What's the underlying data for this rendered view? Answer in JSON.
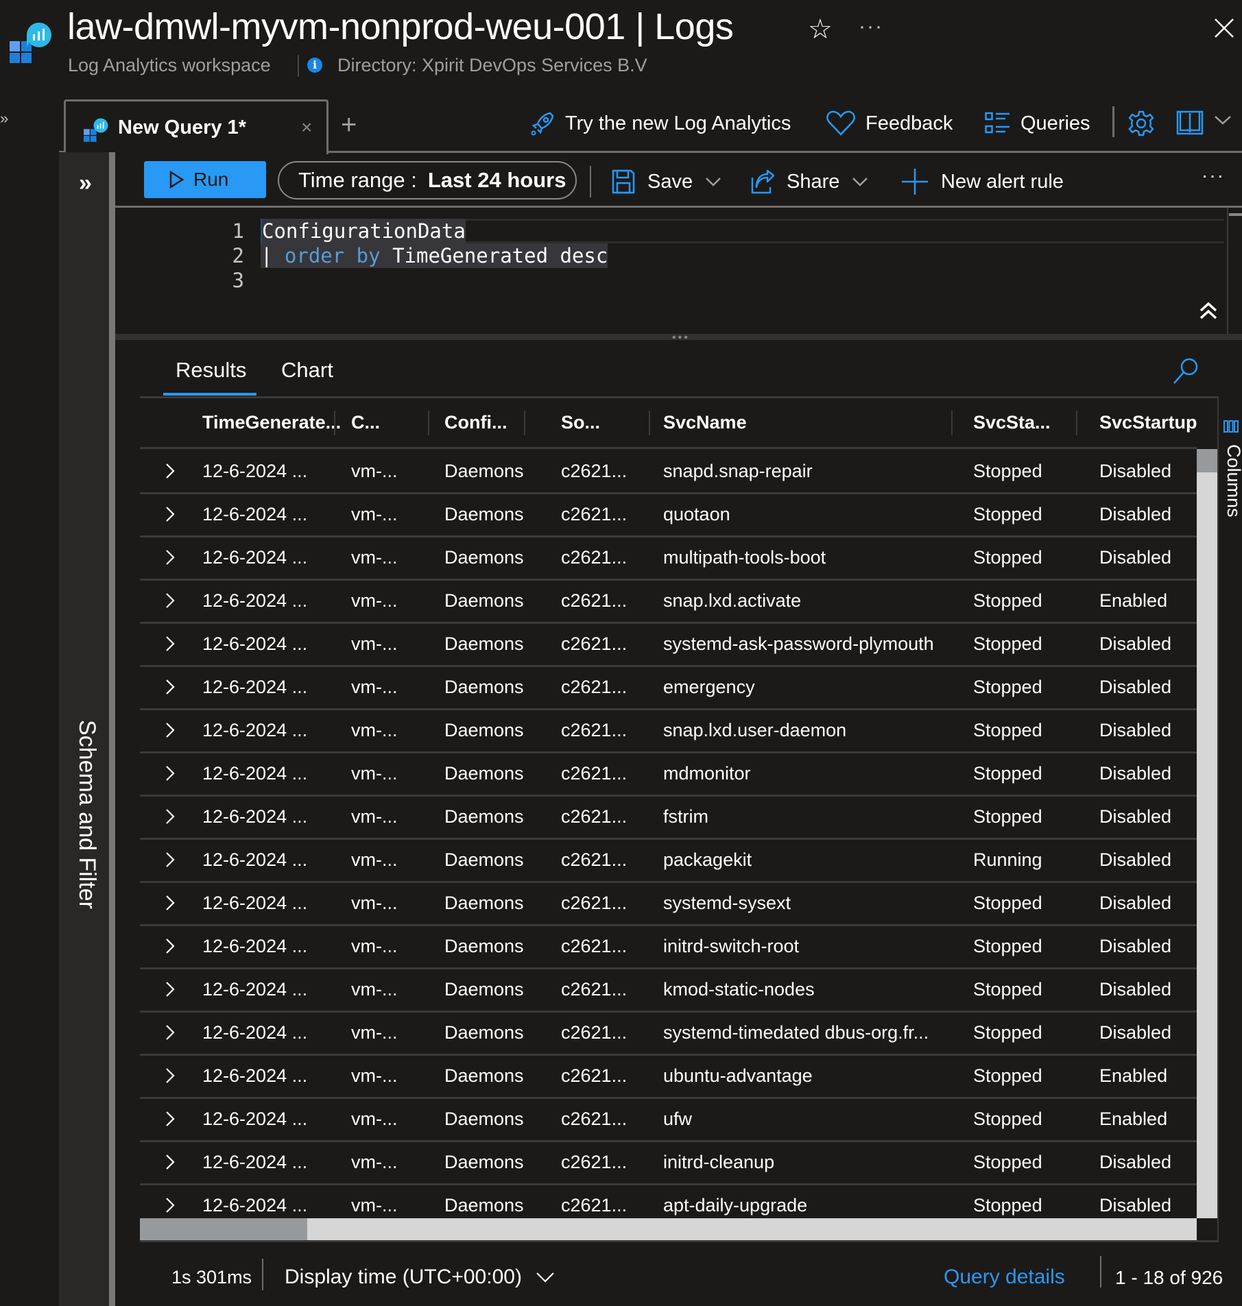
{
  "header": {
    "title": "law-dmwl-myvm-nonprod-weu-001 | Logs",
    "subtitle": "Log Analytics workspace",
    "directory": "Directory: Xpirit DevOps Services B.V",
    "info_icon": "i",
    "star_icon": "☆",
    "more_icon": "···",
    "close_icon": "close-icon"
  },
  "left_collapse_icon": "»",
  "query_tabs": [
    {
      "label": "New Query 1*",
      "close": "×",
      "active": true
    }
  ],
  "add_tab_icon": "+",
  "top_actions": {
    "try_new": "Try the new Log Analytics",
    "feedback": "Feedback",
    "queries": "Queries"
  },
  "schema_panel": {
    "expand_icon": "»",
    "label": "Schema and Filter"
  },
  "toolbar": {
    "run_label": "Run",
    "time_range_label": "Time range :",
    "time_range_value": "Last 24 hours",
    "save_label": "Save",
    "share_label": "Share",
    "new_alert_label": "New alert rule",
    "more_icon": "···"
  },
  "editor": {
    "lines": [
      {
        "num": "1",
        "text": "ConfigurationData"
      },
      {
        "num": "2",
        "pipe": "| ",
        "keyword": "order by",
        "rest": " TimeGenerated desc"
      },
      {
        "num": "3",
        "text": ""
      }
    ]
  },
  "splitter_dots": "•••",
  "results": {
    "tabs": [
      {
        "label": "Results",
        "active": true
      },
      {
        "label": "Chart",
        "active": false
      }
    ],
    "columns": [
      "TimeGenerate...",
      "C...",
      "Confi...",
      "So...",
      "SvcName",
      "SvcSta...",
      "SvcStartupTyp"
    ],
    "rows": [
      [
        "12-6-2024 ...",
        "vm-...",
        "Daemons",
        "c2621...",
        "snapd.snap-repair",
        "Stopped",
        "Disabled"
      ],
      [
        "12-6-2024 ...",
        "vm-...",
        "Daemons",
        "c2621...",
        "quotaon",
        "Stopped",
        "Disabled"
      ],
      [
        "12-6-2024 ...",
        "vm-...",
        "Daemons",
        "c2621...",
        "multipath-tools-boot",
        "Stopped",
        "Disabled"
      ],
      [
        "12-6-2024 ...",
        "vm-...",
        "Daemons",
        "c2621...",
        "snap.lxd.activate",
        "Stopped",
        "Enabled"
      ],
      [
        "12-6-2024 ...",
        "vm-...",
        "Daemons",
        "c2621...",
        "systemd-ask-password-plymouth",
        "Stopped",
        "Disabled"
      ],
      [
        "12-6-2024 ...",
        "vm-...",
        "Daemons",
        "c2621...",
        "emergency",
        "Stopped",
        "Disabled"
      ],
      [
        "12-6-2024 ...",
        "vm-...",
        "Daemons",
        "c2621...",
        "snap.lxd.user-daemon",
        "Stopped",
        "Disabled"
      ],
      [
        "12-6-2024 ...",
        "vm-...",
        "Daemons",
        "c2621...",
        "mdmonitor",
        "Stopped",
        "Disabled"
      ],
      [
        "12-6-2024 ...",
        "vm-...",
        "Daemons",
        "c2621...",
        "fstrim",
        "Stopped",
        "Disabled"
      ],
      [
        "12-6-2024 ...",
        "vm-...",
        "Daemons",
        "c2621...",
        "packagekit",
        "Running",
        "Disabled"
      ],
      [
        "12-6-2024 ...",
        "vm-...",
        "Daemons",
        "c2621...",
        "systemd-sysext",
        "Stopped",
        "Disabled"
      ],
      [
        "12-6-2024 ...",
        "vm-...",
        "Daemons",
        "c2621...",
        "initrd-switch-root",
        "Stopped",
        "Disabled"
      ],
      [
        "12-6-2024 ...",
        "vm-...",
        "Daemons",
        "c2621...",
        "kmod-static-nodes",
        "Stopped",
        "Disabled"
      ],
      [
        "12-6-2024 ...",
        "vm-...",
        "Daemons",
        "c2621...",
        "systemd-timedated dbus-org.fr...",
        "Stopped",
        "Disabled"
      ],
      [
        "12-6-2024 ...",
        "vm-...",
        "Daemons",
        "c2621...",
        "ubuntu-advantage",
        "Stopped",
        "Enabled"
      ],
      [
        "12-6-2024 ...",
        "vm-...",
        "Daemons",
        "c2621...",
        "ufw",
        "Stopped",
        "Enabled"
      ],
      [
        "12-6-2024 ...",
        "vm-...",
        "Daemons",
        "c2621...",
        "initrd-cleanup",
        "Stopped",
        "Disabled"
      ],
      [
        "12-6-2024 ...",
        "vm-...",
        "Daemons",
        "c2621...",
        "apt-daily-upgrade",
        "Stopped",
        "Disabled"
      ]
    ],
    "columns_panel_label": "Columns"
  },
  "footer": {
    "exec_time": "1s 301ms",
    "display_time": "Display time (UTC+00:00)",
    "query_details": "Query details",
    "record_count": "1 - 18 of 926"
  },
  "colors": {
    "accent": "#2899f5",
    "background": "#1b1a19",
    "panel": "#292827",
    "keyword": "#569cd6"
  }
}
